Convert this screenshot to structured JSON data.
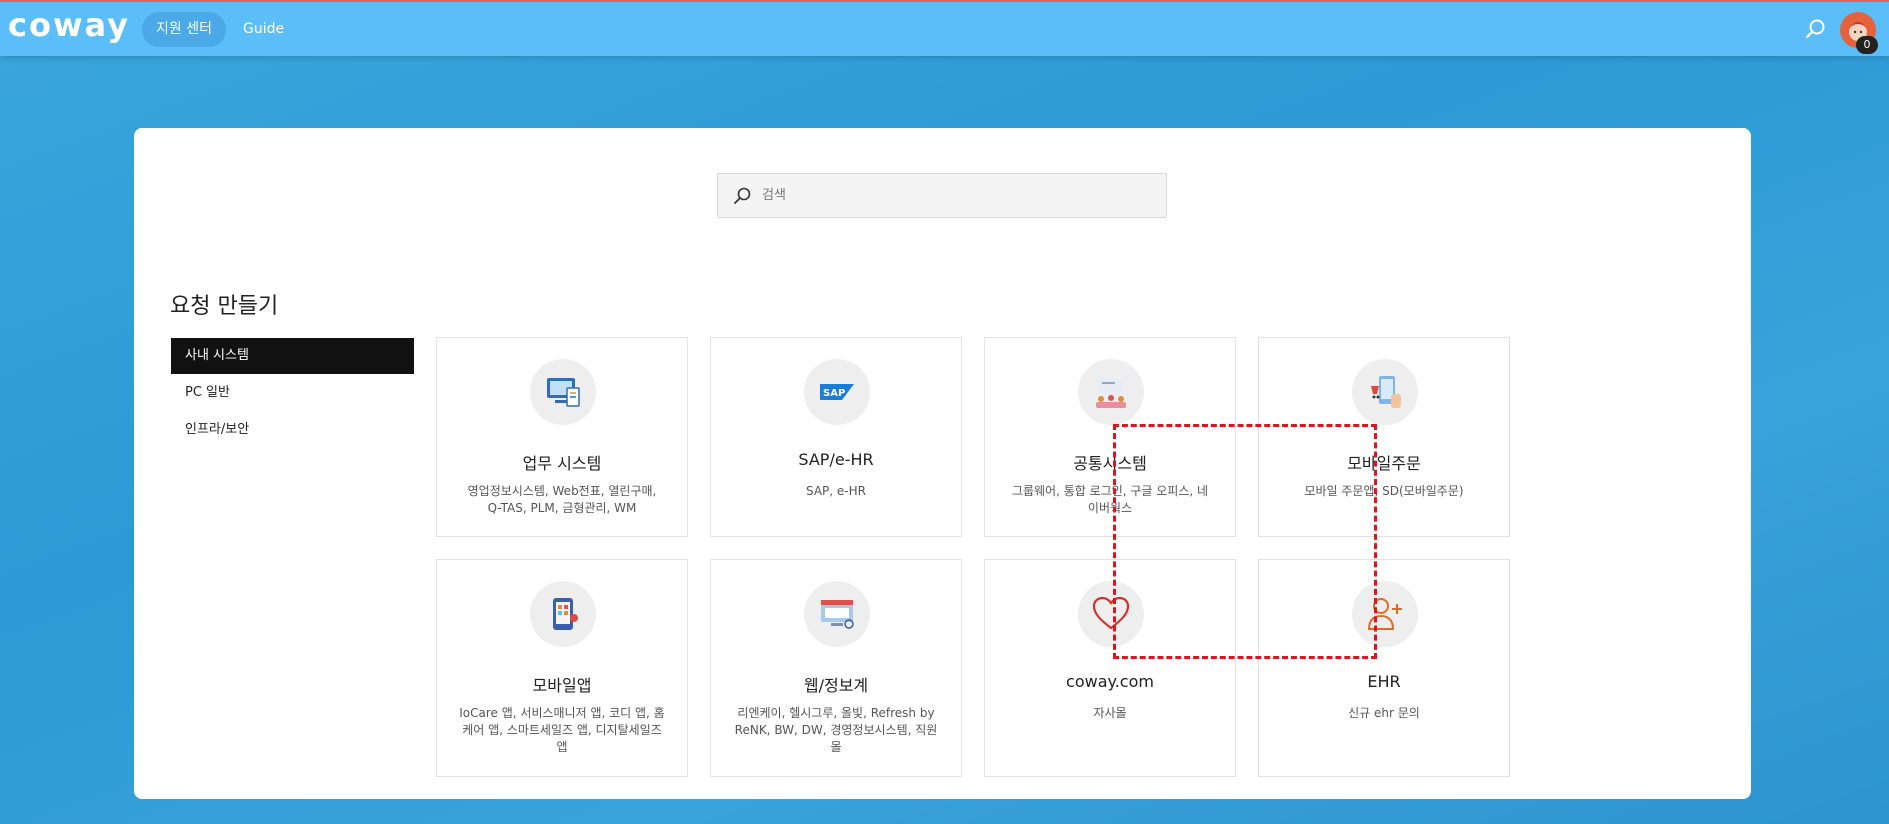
{
  "topbar": {
    "logo": "coway",
    "nav": [
      {
        "label": "지원 센터",
        "active": true
      },
      {
        "label": "Guide",
        "active": false
      }
    ],
    "search_icon": "search-icon",
    "cart_count": "0",
    "accent": "#5bbef8"
  },
  "search": {
    "placeholder": "검색"
  },
  "section_title": "요청 만들기",
  "sidebar": {
    "items": [
      {
        "label": "사내 시스템",
        "active": true
      },
      {
        "label": "PC 일반",
        "active": false
      },
      {
        "label": "인프라/보안",
        "active": false
      }
    ]
  },
  "tiles": [
    {
      "title": "업무 시스템",
      "desc": "영업정보시스템, Web전표, 열린구매, Q-TAS, PLM, 금형관리, WM",
      "icon": "business-system-icon"
    },
    {
      "title": "SAP/e-HR",
      "desc": "SAP, e-HR",
      "icon": "sap-logo-icon"
    },
    {
      "title": "공통시스템",
      "desc": "그룹웨어, 통합 로그인, 구글 오피스, 네이버웍스",
      "icon": "common-system-icon"
    },
    {
      "title": "모바일주문",
      "desc": "모바일 주문앱, SD(모바일주문)",
      "icon": "mobile-order-icon"
    },
    {
      "title": "모바일앱",
      "desc": "IoCare 앱, 서비스매니저 앱, 코디 앱, 홈케어 앱, 스마트세일즈 앱, 디지탈세일즈 앱",
      "icon": "mobile-app-icon"
    },
    {
      "title": "웹/정보계",
      "desc": "리엔케이, 헬시그루, 올빛, Refresh by ReNK, BW, DW, 경영정보시스템, 직원몰",
      "icon": "web-info-icon"
    },
    {
      "title": "coway.com",
      "desc": "자사몰",
      "icon": "heart-icon"
    },
    {
      "title": "EHR",
      "desc": "신규 ehr 문의",
      "icon": "add-user-icon"
    }
  ]
}
